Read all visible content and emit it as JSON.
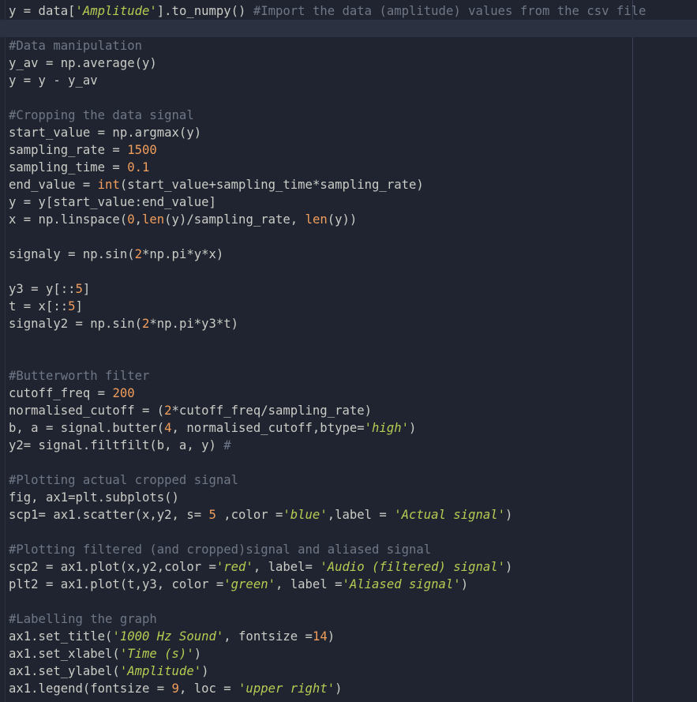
{
  "editor": {
    "code_lines": [
      [
        {
          "t": "y = data["
        },
        {
          "t": "'Amplitude'",
          "k": "s"
        },
        {
          "t": "].to_numpy() "
        },
        {
          "t": "#Import the data (amplitude) values from the csv file",
          "k": "c"
        }
      ],
      [],
      [
        {
          "t": "#Data manipulation",
          "k": "c"
        }
      ],
      [
        {
          "t": "y_av = np.average(y)"
        }
      ],
      [
        {
          "t": "y = y - y_av"
        }
      ],
      [],
      [
        {
          "t": "#Cropping the data signal",
          "k": "c"
        }
      ],
      [
        {
          "t": "start_value = np.argmax(y)"
        }
      ],
      [
        {
          "t": "sampling_rate = "
        },
        {
          "t": "1500",
          "k": "n"
        }
      ],
      [
        {
          "t": "sampling_time = "
        },
        {
          "t": "0.1",
          "k": "n"
        }
      ],
      [
        {
          "t": "end_value = "
        },
        {
          "t": "int",
          "k": "b"
        },
        {
          "t": "(start_value+sampling_time*sampling_rate)"
        }
      ],
      [
        {
          "t": "y = y[start_value:end_value]"
        }
      ],
      [
        {
          "t": "x = np.linspace("
        },
        {
          "t": "0",
          "k": "n"
        },
        {
          "t": ","
        },
        {
          "t": "len",
          "k": "b"
        },
        {
          "t": "(y)/sampling_rate, "
        },
        {
          "t": "len",
          "k": "b"
        },
        {
          "t": "(y))"
        }
      ],
      [],
      [
        {
          "t": "signaly = np.sin("
        },
        {
          "t": "2",
          "k": "n"
        },
        {
          "t": "*np.pi*y*x)"
        }
      ],
      [],
      [
        {
          "t": "y3 = y[::"
        },
        {
          "t": "5",
          "k": "n"
        },
        {
          "t": "]"
        }
      ],
      [
        {
          "t": "t = x[::"
        },
        {
          "t": "5",
          "k": "n"
        },
        {
          "t": "]"
        }
      ],
      [
        {
          "t": "signaly2 = np.sin("
        },
        {
          "t": "2",
          "k": "n"
        },
        {
          "t": "*np.pi*y3*t)"
        }
      ],
      [],
      [],
      [
        {
          "t": "#Butterworth filter",
          "k": "c"
        }
      ],
      [
        {
          "t": "cutoff_freq = "
        },
        {
          "t": "200",
          "k": "n"
        }
      ],
      [
        {
          "t": "normalised_cutoff = ("
        },
        {
          "t": "2",
          "k": "n"
        },
        {
          "t": "*cutoff_freq/sampling_rate)"
        }
      ],
      [
        {
          "t": "b, a = signal.butter("
        },
        {
          "t": "4",
          "k": "n"
        },
        {
          "t": ", normalised_cutoff,btype="
        },
        {
          "t": "'high'",
          "k": "s"
        },
        {
          "t": ")"
        }
      ],
      [
        {
          "t": "y2= signal.filtfilt(b, a, y) "
        },
        {
          "t": "#",
          "k": "c"
        }
      ],
      [],
      [
        {
          "t": "#Plotting actual cropped signal",
          "k": "c"
        }
      ],
      [
        {
          "t": "fig, ax1=plt.subplots()"
        }
      ],
      [
        {
          "t": "scp1= ax1.scatter(x,y2, s= "
        },
        {
          "t": "5",
          "k": "n"
        },
        {
          "t": " ,color ="
        },
        {
          "t": "'blue'",
          "k": "s"
        },
        {
          "t": ",label = "
        },
        {
          "t": "'Actual signal'",
          "k": "s"
        },
        {
          "t": ")"
        }
      ],
      [],
      [
        {
          "t": "#Plotting filtered (and cropped)signal and aliased signal",
          "k": "c"
        }
      ],
      [
        {
          "t": "scp2 = ax1.plot(x,y2,color ="
        },
        {
          "t": "'red'",
          "k": "s"
        },
        {
          "t": ", label= "
        },
        {
          "t": "'Audio (filtered) signal'",
          "k": "s"
        },
        {
          "t": ")"
        }
      ],
      [
        {
          "t": "plt2 = ax1.plot(t,y3, color ="
        },
        {
          "t": "'green'",
          "k": "s"
        },
        {
          "t": ", label ="
        },
        {
          "t": "'Aliased signal'",
          "k": "s"
        },
        {
          "t": ")"
        }
      ],
      [],
      [
        {
          "t": "#Labelling the graph",
          "k": "c"
        }
      ],
      [
        {
          "t": "ax1.set_title("
        },
        {
          "t": "'1000 Hz Sound'",
          "k": "s"
        },
        {
          "t": ", fontsize ="
        },
        {
          "t": "14",
          "k": "n"
        },
        {
          "t": ")"
        }
      ],
      [
        {
          "t": "ax1.set_xlabel("
        },
        {
          "t": "'Time (s)'",
          "k": "s"
        },
        {
          "t": ")"
        }
      ],
      [
        {
          "t": "ax1.set_ylabel("
        },
        {
          "t": "'Amplitude'",
          "k": "s"
        },
        {
          "t": ")"
        }
      ],
      [
        {
          "t": "ax1.legend(fontsize = "
        },
        {
          "t": "9",
          "k": "n"
        },
        {
          "t": ", loc = "
        },
        {
          "t": "'upper right'",
          "k": "s"
        },
        {
          "t": ")"
        }
      ]
    ],
    "active_line": 1
  },
  "colors": {
    "background": "#1f2430",
    "active_line": "#2b3140",
    "text": "#cbccc6",
    "comment": "#6f7787",
    "string": "#b8cc52",
    "number": "#f29e5c",
    "builtin": "#f29e5c"
  }
}
